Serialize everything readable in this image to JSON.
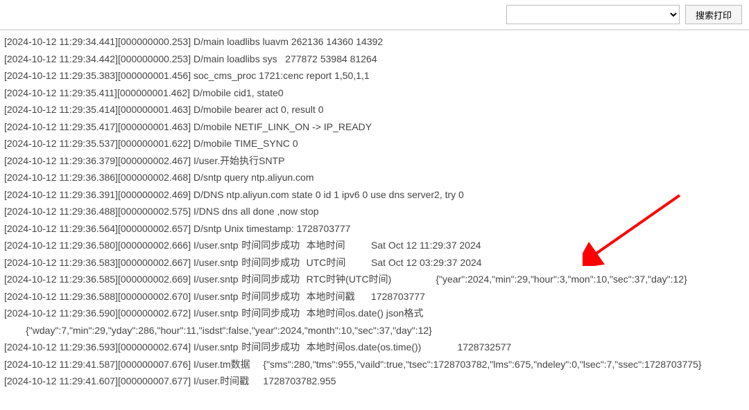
{
  "toolbar": {
    "dropdown_selected": "",
    "search_button_label": "搜索打印"
  },
  "log": {
    "lines": [
      "[2024-10-12 11:29:34.441][000000000.253] D/main loadlibs luavm 262136 14360 14392",
      "[2024-10-12 11:29:34.442][000000000.253] D/main loadlibs sys   277872 53984 81264",
      "[2024-10-12 11:29:35.383][000000001.456] soc_cms_proc 1721:cenc report 1,50,1,1",
      "[2024-10-12 11:29:35.411][000000001.462] D/mobile cid1, state0",
      "[2024-10-12 11:29:35.414][000000001.463] D/mobile bearer act 0, result 0",
      "[2024-10-12 11:29:35.417][000000001.463] D/mobile NETIF_LINK_ON -> IP_READY",
      "[2024-10-12 11:29:35.537][000000001.622] D/mobile TIME_SYNC 0",
      "[2024-10-12 11:29:36.379][000000002.467] I/user.开始执行SNTP",
      "[2024-10-12 11:29:36.386][000000002.468] D/sntp query ntp.aliyun.com",
      "[2024-10-12 11:29:36.391][000000002.469] D/DNS ntp.aliyun.com state 0 id 1 ipv6 0 use dns server2, try 0",
      "[2024-10-12 11:29:36.488][000000002.575] I/DNS dns all done ,now stop",
      "[2024-10-12 11:29:36.564][000000002.657] D/sntp Unix timestamp: 1728703777",
      "[2024-10-12 11:29:36.580][000000002.666] I/user.sntp\t时间同步成功\t本地时间\t\tSat Oct 12 11:29:37 2024",
      "[2024-10-12 11:29:36.583][000000002.667] I/user.sntp\t时间同步成功\tUTC时间\t\tSat Oct 12 03:29:37 2024",
      "[2024-10-12 11:29:36.585][000000002.669] I/user.sntp\t时间同步成功\tRTC时钟(UTC时间)\t\t{\"year\":2024,\"min\":29,\"hour\":3,\"mon\":10,\"sec\":37,\"day\":12}",
      "[2024-10-12 11:29:36.588][000000002.670] I/user.sntp\t时间同步成功\t本地时间戳\t1728703777",
      "[2024-10-12 11:29:36.590][000000002.672] I/user.sntp\t时间同步成功\t本地时间os.date() json格式",
      "\t{\"wday\":7,\"min\":29,\"yday\":286,\"hour\":11,\"isdst\":false,\"year\":2024,\"month\":10,\"sec\":37,\"day\":12}",
      "[2024-10-12 11:29:36.593][000000002.674] I/user.sntp\t时间同步成功\t本地时间os.date(os.time())\t\t1728732577",
      "[2024-10-12 11:29:41.587][000000007.676] I/user.tm数据\t{\"sms\":280,\"tms\":955,\"vaild\":true,\"tsec\":1728703782,\"lms\":675,\"ndeley\":0,\"lsec\":7,\"ssec\":1728703775}",
      "[2024-10-12 11:29:41.607][000000007.677] I/user.时间戳\t1728703782.955"
    ]
  },
  "annotation": {
    "arrow_color": "#ff0000"
  }
}
